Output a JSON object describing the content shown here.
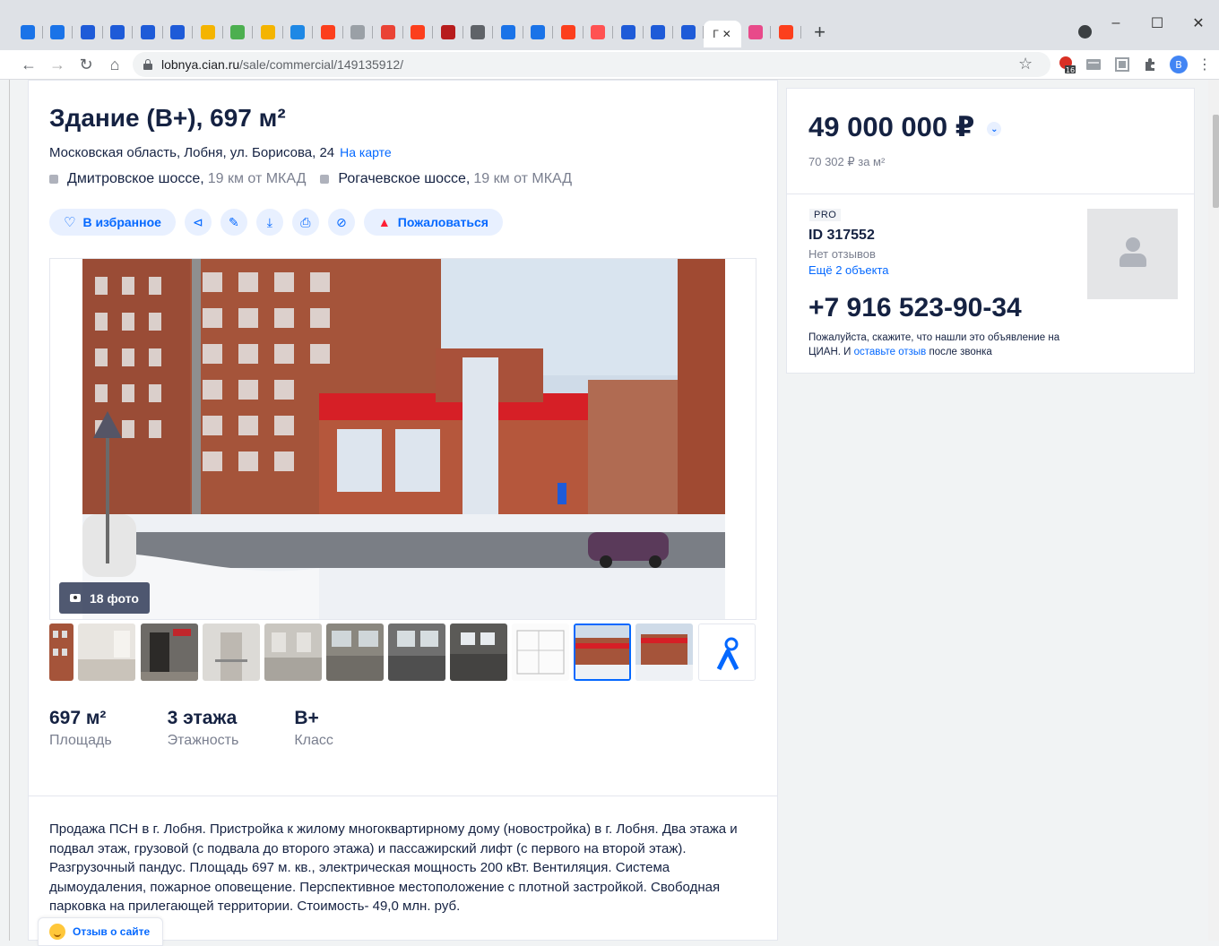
{
  "browser": {
    "url_domain": "lobnya.cian.ru",
    "url_path": "/sale/commercial/149135912/",
    "active_tab_label": "Г",
    "new_tab_label": "+",
    "tab_colors": [
      "#1a73e8",
      "#1a73e8",
      "#1e5bd8",
      "#1e5bd8",
      "#1e5bd8",
      "#1e5bd8",
      "#f4b400",
      "#4caf50",
      "#f4b400",
      "#1e88e5",
      "#fc3f1d",
      "#9aa0a6",
      "#ea4335",
      "#fc3f1d",
      "#b71c1c",
      "#5f6368",
      "#1a73e8",
      "#1a73e8",
      "#fc3f1d",
      "#ff5252",
      "#1e5bd8",
      "#1e5bd8",
      "#1e5bd8"
    ],
    "extension_badge": "16",
    "profile_letter": "B"
  },
  "listing": {
    "title": "Здание (В+), 697 м²",
    "address": "Московская область, Лобня, ул. Борисова, 24",
    "map_link": "На карте",
    "highways": [
      {
        "name": "Дмитровское шоссе,",
        "distance": "19 км от МКАД"
      },
      {
        "name": "Рогачевское шоссе,",
        "distance": "19 км от МКАД"
      }
    ],
    "actions": {
      "favorite": "В избранное",
      "complain": "Пожаловаться"
    },
    "photo_count": "18 фото",
    "params": [
      {
        "value": "697 м²",
        "label": "Площадь"
      },
      {
        "value": "3 этажа",
        "label": "Этажность"
      },
      {
        "value": "B+",
        "label": "Класс"
      }
    ],
    "description": "Продажа ПСН в г. Лобня. Пристройка к жилому многоквартирному дому (новостройка) в  г. Лобня. Два этажа и подвал этаж, грузовой (с подвала до второго этажа) и пассажирский лифт (с первого на второй этаж). Разгрузочный пандус. Площадь 697 м. кв., электрическая мощность 200 кВт. Вентиляция. Система дымоудаления, пожарное оповещение. Перспективное местоположение с плотной застройкой. Свободная парковка на прилегающей территории. Стоимость- 49,0 млн. руб."
  },
  "sidebar": {
    "price": "49 000 000 ₽",
    "price_per_m": "70 302 ₽ за м²",
    "pro_badge": "PRO",
    "agent_id": "ID 317552",
    "reviews": "Нет отзывов",
    "more_objects": "Ещё 2 объекта",
    "phone": "+7 916 523-90-34",
    "call_note_pre": "Пожалуйста, скажите, что нашли это объявление на ЦИАН. И ",
    "call_note_link": "оставьте отзыв",
    "call_note_post": " после звонка"
  },
  "feedback": {
    "label": "Отзыв о сайте"
  },
  "colors": {
    "accent": "#0468ff",
    "text": "#152242",
    "muted": "#7a7f8f",
    "danger": "#ff1f34"
  }
}
